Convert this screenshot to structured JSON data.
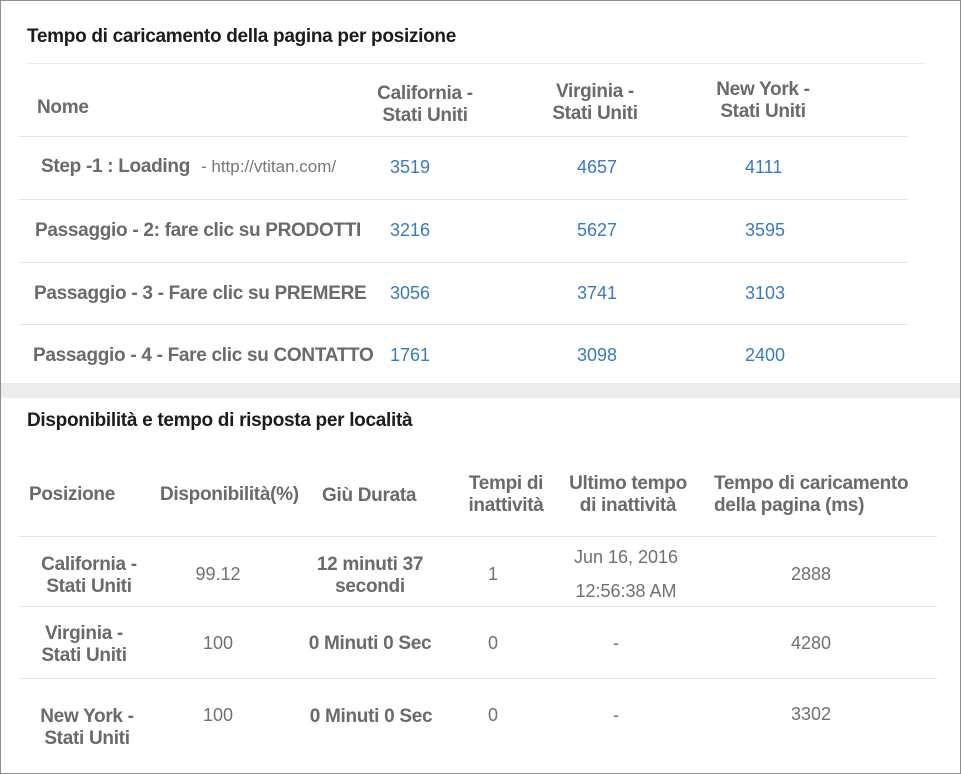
{
  "page_load_table": {
    "title": "Tempo di caricamento della pagina per posizione",
    "headers": {
      "name": "Nome",
      "loc1_line1": "California -",
      "loc1_line2": "Stati Uniti",
      "loc2_line1": "Virginia -",
      "loc2_line2": "Stati Uniti",
      "loc3_line1": "New York -",
      "loc3_line2": "Stati Uniti"
    },
    "rows": [
      {
        "label": "Step -1 : Loading",
        "url": "- http://vtitan.com/",
        "v1": "3519",
        "v2": "4657",
        "v3": "4111"
      },
      {
        "label": "Passaggio - 2: fare clic su PRODOTTI",
        "v1": "3216",
        "v2": "5627",
        "v3": "3595"
      },
      {
        "label": "Passaggio - 3 - Fare clic su PREMERE",
        "v1": "3056",
        "v2": "3741",
        "v3": "3103"
      },
      {
        "label": "Passaggio - 4 - Fare clic su CONTATTO",
        "v1": "1761",
        "v2": "3098",
        "v3": "2400"
      }
    ]
  },
  "availability_table": {
    "title": "Disponibilità e tempo di risposta per località",
    "headers": {
      "location": "Posizione",
      "availability": "Disponibilità(%)",
      "downtime": "Giù Durata",
      "outages_line1": "Tempi di",
      "outages_line2": "inattività",
      "last_outage_line1": "Ultimo tempo",
      "last_outage_line2": "di inattività",
      "load_time_line1": "Tempo di caricamento",
      "load_time_line2": "della pagina (ms)"
    },
    "rows": [
      {
        "loc_line1": "California -",
        "loc_line2": "Stati Uniti",
        "availability": "99.12",
        "downtime_line1": "12 minuti 37",
        "downtime_line2": "secondi",
        "outages": "1",
        "last_line1": "Jun 16, 2016",
        "last_line2": "12:56:38 AM",
        "load": "2888"
      },
      {
        "loc_line1": "Virginia -",
        "loc_line2": "Stati Uniti",
        "availability": "100",
        "downtime_line1": "0 Minuti 0 Sec",
        "outages": "0",
        "last_line1": "-",
        "load": "4280"
      },
      {
        "loc_line1": "New York -",
        "loc_line2": "Stati Uniti",
        "availability": "100",
        "downtime_line1": "0 Minuti 0 Sec",
        "outages": "0",
        "last_line1": "-",
        "load": "3302"
      }
    ]
  }
}
